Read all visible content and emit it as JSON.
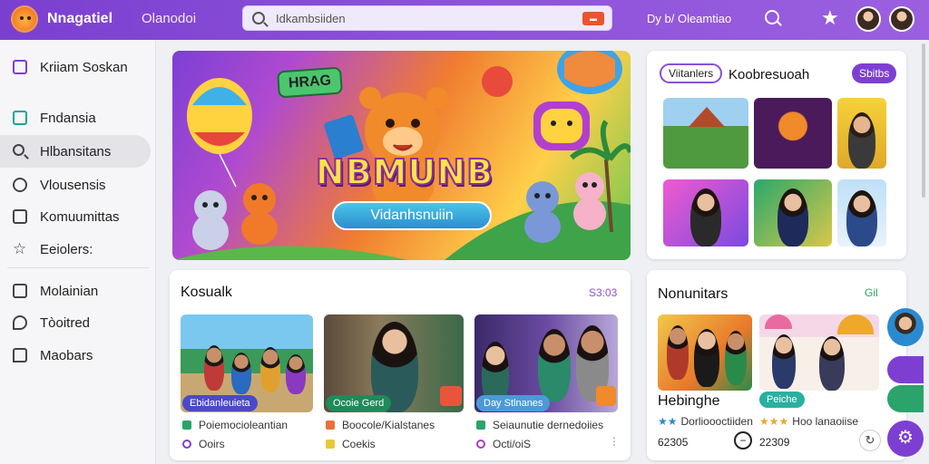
{
  "header": {
    "brand": "Nnagatiel",
    "nav_item": "Olanodoi",
    "search_placeholder": "Idkambsiiden",
    "link": "Dy b/ Oleamtiao"
  },
  "sidebar": {
    "items": [
      {
        "label": "Kriiam Soskan",
        "icon": "calendar-icon"
      },
      {
        "label": "Fndansia",
        "icon": "square-icon"
      },
      {
        "label": "Hlbansitans",
        "icon": "search-icon"
      },
      {
        "label": "Vlousensis",
        "icon": "compass-icon"
      },
      {
        "label": "Komuumittas",
        "icon": "folder-icon"
      },
      {
        "label": "Eeiolers:",
        "icon": "star-icon"
      },
      {
        "label": "Molainian",
        "icon": "box-icon"
      },
      {
        "label": "Tòoitred",
        "icon": "bubble-icon"
      },
      {
        "label": "Maobars",
        "icon": "chat-icon"
      }
    ]
  },
  "hero": {
    "tag": "HRAG",
    "title": "NBMUNB",
    "pill": "Vidanhsnuiin"
  },
  "top_right_card": {
    "chip": "Viitanlers",
    "title": "Koobresuoah",
    "badge": "Sbitbs"
  },
  "featured_card": {
    "title": "Kosualk",
    "count": "S3:03",
    "items": [
      {
        "tag": "Ebidanleuieta",
        "tag_color": "#4b49c8",
        "meta1": "Poiemocioleantian",
        "meta2": "Ooirs"
      },
      {
        "tag": "Ocoie Gerd",
        "tag_color": "#1f8a5a",
        "meta1": "Boocole/Kialstanes",
        "meta2": "Coekis"
      },
      {
        "tag": "Day Stlnanes",
        "tag_color": "#4b9ad8",
        "meta1": "Seiaunutie dernedoiies",
        "meta2": "Octi/oiS"
      }
    ]
  },
  "community_card": {
    "title": "Nonunitars",
    "count": "Gil",
    "name": "Hebinghe",
    "rating1": "Dorlioooctiiden",
    "rating2": "Hoo lanaoiise",
    "tag": "Peiche",
    "num1": "62305",
    "num2": "22309"
  },
  "colors": {
    "header": "#7b3fd0",
    "accent": "#7d3fd2",
    "green": "#2aa46a"
  }
}
